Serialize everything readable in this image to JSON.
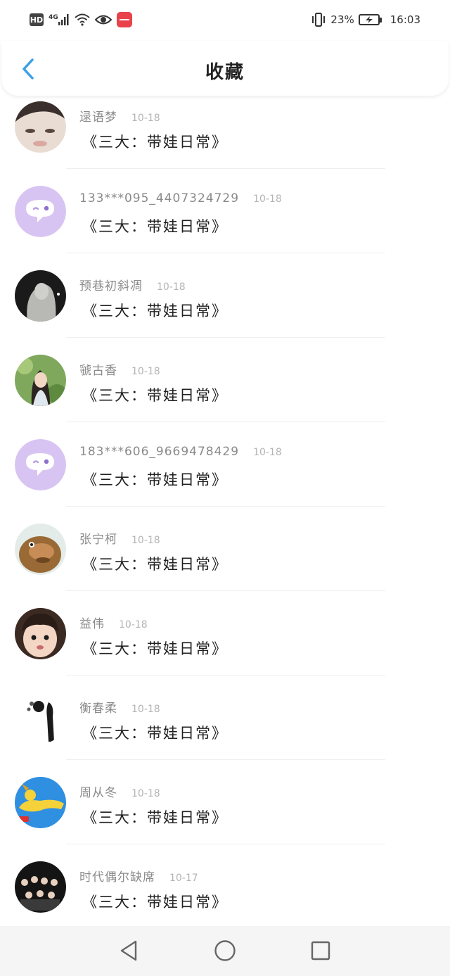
{
  "status_bar": {
    "hd": "HD",
    "network": "4G",
    "battery": "23%",
    "time": "16:03",
    "icons": [
      "hd-icon",
      "signal-icon",
      "wifi-icon",
      "eye-icon",
      "app-notification-icon",
      "vibrate-icon",
      "battery-icon"
    ]
  },
  "header": {
    "title": "收藏",
    "back_icon": "chevron-left-icon",
    "accent": "#3aa0e8"
  },
  "items": [
    {
      "name": "逯语梦",
      "date": "10-18",
      "title": "《三大：带娃日常》",
      "avatar": "photo"
    },
    {
      "name": "133***095_4407324729",
      "date": "10-18",
      "title": "《三大：带娃日常》",
      "avatar": "default-chat"
    },
    {
      "name": "预巷初斜凋",
      "date": "10-18",
      "title": "《三大：带娃日常》",
      "avatar": "photo"
    },
    {
      "name": "虢古香",
      "date": "10-18",
      "title": "《三大：带娃日常》",
      "avatar": "photo"
    },
    {
      "name": "183***606_9669478429",
      "date": "10-18",
      "title": "《三大：带娃日常》",
      "avatar": "default-chat"
    },
    {
      "name": "张宁柯",
      "date": "10-18",
      "title": "《三大：带娃日常》",
      "avatar": "photo"
    },
    {
      "name": "益伟",
      "date": "10-18",
      "title": "《三大：带娃日常》",
      "avatar": "photo"
    },
    {
      "name": "衡春柔",
      "date": "10-18",
      "title": "《三大：带娃日常》",
      "avatar": "photo"
    },
    {
      "name": "周从冬",
      "date": "10-18",
      "title": "《三大：带娃日常》",
      "avatar": "photo"
    },
    {
      "name": "时代偶尔缺席",
      "date": "10-17",
      "title": "《三大：带娃日常》",
      "avatar": "photo"
    }
  ],
  "nav_bar": {
    "icons": [
      "back-triangle-icon",
      "home-circle-icon",
      "recents-square-icon"
    ]
  },
  "colors": {
    "default_avatar": "#d8c4f2",
    "name": "#8a8a8a",
    "date": "#b4b4b4",
    "title": "#222222"
  }
}
